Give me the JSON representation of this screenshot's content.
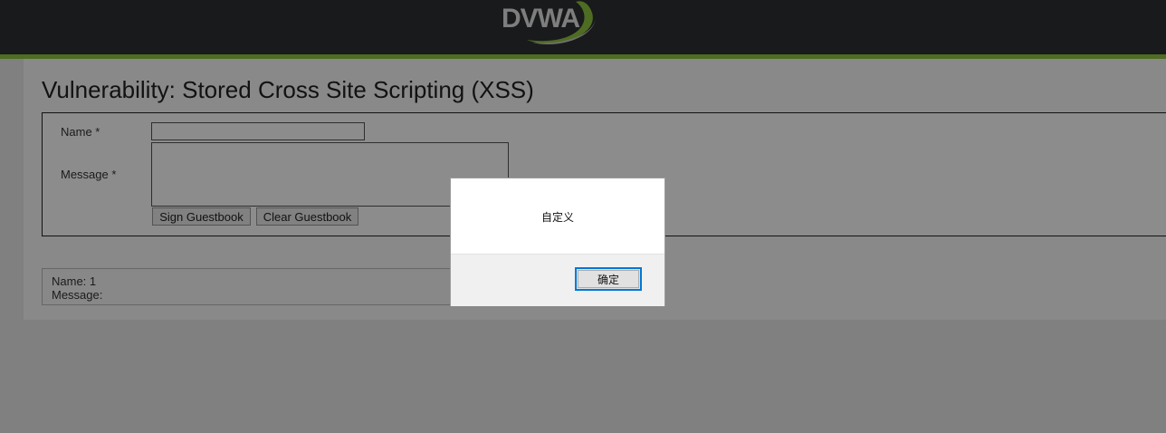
{
  "header": {
    "logo_text": "DVWA"
  },
  "page": {
    "title": "Vulnerability: Stored Cross Site Scripting (XSS)"
  },
  "form": {
    "name_label": "Name *",
    "message_label": "Message *",
    "name_value": "",
    "message_value": "",
    "sign_button": "Sign Guestbook",
    "clear_button": "Clear Guestbook"
  },
  "guestbook": {
    "entries": [
      {
        "name_line": "Name: 1",
        "message_line": "Message:"
      }
    ]
  },
  "dialog": {
    "message": "自定义",
    "ok_label": "确定"
  },
  "colors": {
    "header_bg": "#2f3032",
    "accent_green": "#8ec63f",
    "dialog_button_border": "#0078d7"
  }
}
